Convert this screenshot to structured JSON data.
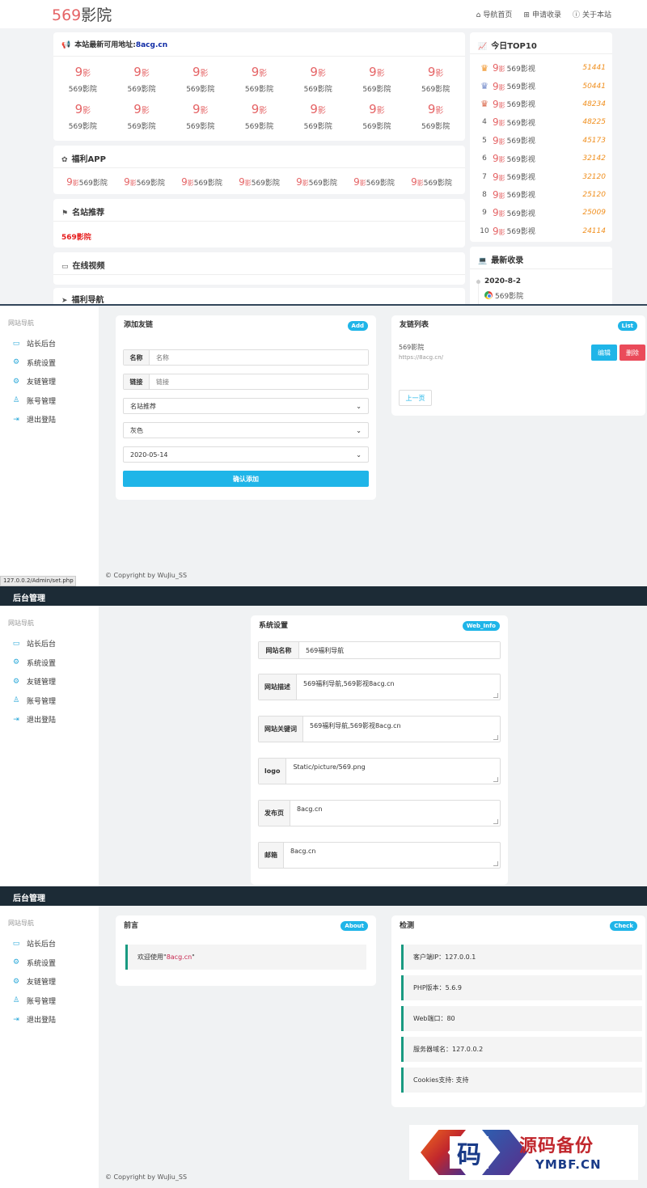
{
  "front": {
    "logo_num": "569",
    "logo_text": "影院",
    "nav": [
      {
        "icon": "home-icon",
        "glyph": "⌂",
        "label": "导航首页"
      },
      {
        "icon": "plus-square-icon",
        "glyph": "⊞",
        "label": "申请收录"
      },
      {
        "icon": "info-icon",
        "glyph": "ⓘ",
        "label": "关于本站"
      }
    ],
    "notice_label": "本站最新可用地址:",
    "notice_link": "8acg.cn",
    "grid_icon_num": "9",
    "grid_icon_char": "影",
    "grid_items": [
      "569影院",
      "569影院",
      "569影院",
      "569影院",
      "569影院",
      "569影院",
      "569影院",
      "569影院",
      "569影院",
      "569影院",
      "569影院",
      "569影院",
      "569影院",
      "569影院"
    ],
    "fuli_app_title": "福利APP",
    "fuli_items": [
      "569影院",
      "569影院",
      "569影院",
      "569影院",
      "569影院",
      "569影院",
      "569影院"
    ],
    "famous_title": "名站推荐",
    "famous_link": "569影院",
    "online_title": "在线视频",
    "nav_title": "福利导航",
    "top10_title": "今日TOP10",
    "top10": [
      {
        "rank": "1",
        "name": "569影视",
        "count": "51441"
      },
      {
        "rank": "2",
        "name": "569影视",
        "count": "50441"
      },
      {
        "rank": "3",
        "name": "569影视",
        "count": "48234"
      },
      {
        "rank": "4",
        "name": "569影视",
        "count": "48225"
      },
      {
        "rank": "5",
        "name": "569影视",
        "count": "45173"
      },
      {
        "rank": "6",
        "name": "569影视",
        "count": "32142"
      },
      {
        "rank": "7",
        "name": "569影视",
        "count": "32120"
      },
      {
        "rank": "8",
        "name": "569影视",
        "count": "25120"
      },
      {
        "rank": "9",
        "name": "569影视",
        "count": "25009"
      },
      {
        "rank": "10",
        "name": "569影视",
        "count": "24114"
      }
    ],
    "newest_title": "最新收录",
    "newest_date": "2020-8-2",
    "newest_item": "569影院"
  },
  "admin_header": "后台管理",
  "sidebar": {
    "title": "网站导航",
    "items": [
      {
        "icon": "monitor-icon",
        "glyph": "▭",
        "label": "站长后台"
      },
      {
        "icon": "gear-icon",
        "glyph": "⚙",
        "label": "系统设置"
      },
      {
        "icon": "gear-icon",
        "glyph": "⚙",
        "label": "友链管理"
      },
      {
        "icon": "user-icon",
        "glyph": "♙",
        "label": "账号管理"
      },
      {
        "icon": "logout-icon",
        "glyph": "⇥",
        "label": "退出登陆"
      }
    ]
  },
  "addlink": {
    "title": "添加友链",
    "badge": "Add",
    "name_label": "名称",
    "name_placeholder": "名称",
    "link_label": "链接",
    "link_placeholder": "链接",
    "select_category": "名站推荐",
    "select_color": "灰色",
    "select_date": "2020-05-14",
    "submit": "确认添加"
  },
  "linklist": {
    "title": "友链列表",
    "badge": "List",
    "item_name": "569影院",
    "item_url": "https://8acg.cn/",
    "edit": "编辑",
    "delete": "删除",
    "prev": "上一页"
  },
  "status_url": "127.0.0.2/Admin/set.php",
  "copyright": "© Copyright by WuJiu_SS",
  "settings": {
    "title": "系统设置",
    "badge": "Web_Info",
    "site_name_label": "网站名称",
    "site_name": "569福利导航",
    "desc_label": "网站描述",
    "desc": "569福利导航,569影视8acg.cn",
    "keywords_label": "网站关键词",
    "keywords": "569福利导航,569影视8acg.cn",
    "logo_label": "logo",
    "logo": "Static/picture/569.png",
    "publish_label": "发布页",
    "publish": "8acg.cn",
    "email_label": "邮箱",
    "email": "8acg.cn"
  },
  "preface": {
    "title": "前言",
    "badge": "About",
    "text_prefix": "欢迎使用\"",
    "text_red": "8acg.cn",
    "text_suffix": "\""
  },
  "check": {
    "title": "检测",
    "badge": "Check",
    "items": [
      "客户端IP：127.0.0.1",
      "PHP版本：5.6.9",
      "Web端口：80",
      "服务器域名：127.0.0.2",
      "Cookies支持: 支持"
    ]
  },
  "watermark": {
    "glyph": "码",
    "title": "源码备份",
    "domain": "YMBF.CN"
  }
}
